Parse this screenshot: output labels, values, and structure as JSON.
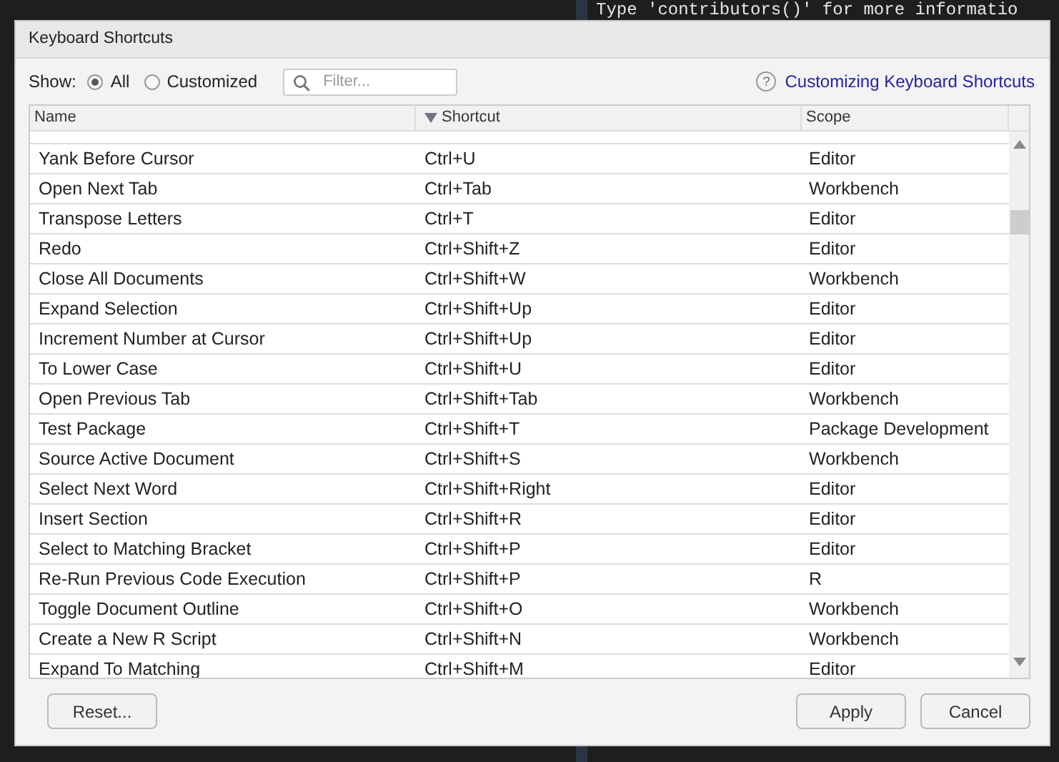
{
  "console": {
    "lines": [
      "Type 'contributors()' for more informatio"
    ]
  },
  "dialog": {
    "title": "Keyboard Shortcuts",
    "show": {
      "label": "Show:",
      "options": [
        {
          "label": "All",
          "selected": true
        },
        {
          "label": "Customized",
          "selected": false
        }
      ]
    },
    "filter": {
      "placeholder": "Filter..."
    },
    "help_icon": "?",
    "help_link": "Customizing Keyboard Shortcuts",
    "table": {
      "columns": [
        {
          "label": "Name",
          "sorted": false
        },
        {
          "label": "Shortcut",
          "sorted": true
        },
        {
          "label": "Scope",
          "sorted": false
        }
      ],
      "rows": [
        [
          "Yank Before Cursor",
          "Ctrl+U",
          "Editor"
        ],
        [
          "Open Next Tab",
          "Ctrl+Tab",
          "Workbench"
        ],
        [
          "Transpose Letters",
          "Ctrl+T",
          "Editor"
        ],
        [
          "Redo",
          "Ctrl+Shift+Z",
          "Editor"
        ],
        [
          "Close All Documents",
          "Ctrl+Shift+W",
          "Workbench"
        ],
        [
          "Expand Selection",
          "Ctrl+Shift+Up",
          "Editor"
        ],
        [
          "Increment Number at Cursor",
          "Ctrl+Shift+Up",
          "Editor"
        ],
        [
          "To Lower Case",
          "Ctrl+Shift+U",
          "Editor"
        ],
        [
          "Open Previous Tab",
          "Ctrl+Shift+Tab",
          "Workbench"
        ],
        [
          "Test Package",
          "Ctrl+Shift+T",
          "Package Development"
        ],
        [
          "Source Active Document",
          "Ctrl+Shift+S",
          "Workbench"
        ],
        [
          "Select Next Word",
          "Ctrl+Shift+Right",
          "Editor"
        ],
        [
          "Insert Section",
          "Ctrl+Shift+R",
          "Editor"
        ],
        [
          "Select to Matching Bracket",
          "Ctrl+Shift+P",
          "Editor"
        ],
        [
          "Re-Run Previous Code Execution",
          "Ctrl+Shift+P",
          "R"
        ],
        [
          "Toggle Document Outline",
          "Ctrl+Shift+O",
          "Workbench"
        ],
        [
          "Create a New R Script",
          "Ctrl+Shift+N",
          "Workbench"
        ],
        [
          "Expand To Matching",
          "Ctrl+Shift+M",
          "Editor"
        ]
      ]
    },
    "buttons_left": [
      "Reset..."
    ],
    "buttons_right": [
      "Apply",
      "Cancel"
    ]
  }
}
